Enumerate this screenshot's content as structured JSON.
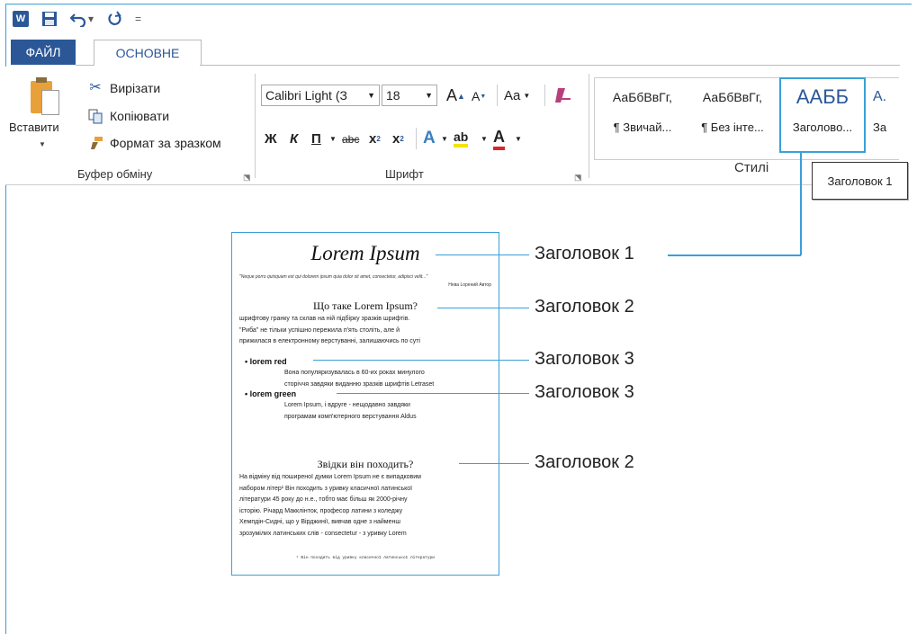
{
  "quick_access": {
    "word_icon": "word-app-icon",
    "save_icon": "save-icon",
    "undo_icon": "undo-icon",
    "undo_menu": "▾",
    "redo_icon": "redo-icon",
    "customize": "="
  },
  "tabs": {
    "file": "ФАЙЛ",
    "home": "ОСНОВНЕ"
  },
  "clipboard": {
    "paste": "Вставити",
    "cut": "Вирізати",
    "copy": "Копіювати",
    "format_painter": "Формат за зразком",
    "group_label": "Буфер обміну"
  },
  "font": {
    "font_name": "Calibri Light (З",
    "font_size": "18",
    "grow": "A",
    "shrink": "A",
    "case": "Aa",
    "bold": "Ж",
    "italic": "К",
    "underline": "П",
    "strike": "abc",
    "subscript": "x",
    "superscript": "x",
    "text_effects": "A",
    "highlight": "ab",
    "font_color": "A",
    "group_label": "Шрифт"
  },
  "styles": {
    "tiles": [
      {
        "sample": "АаБбВвГг,",
        "name": "¶ Звичай..."
      },
      {
        "sample": "АаБбВвГг,",
        "name": "¶ Без інте..."
      },
      {
        "sample": "ААББ",
        "name": "Заголово..."
      },
      {
        "sample": "А.",
        "name": "За"
      }
    ],
    "group_label": "Стилі",
    "tooltip": "Заголовок 1"
  },
  "document": {
    "title": "Lorem Ipsum",
    "quote": "\"Neque porro quisquam est qui dolorem ipsum quia dolor sit amet, consectetur, adipisci velit...\"",
    "author": "Нева Lорений  Автор",
    "h2_first": "Що таке Lorem Ipsum?",
    "para1": [
      "шрифтову гранку та склав на ній підбірку зразків шрифтів.",
      "\"Риба\" не тільки успішно пережила п'ять століть, але й",
      "прижилася в електронному верстуванні, залишаючись по суті"
    ],
    "h3_red": "lorem red",
    "para_red": [
      "Вона популяризувалась в 60-их роках минулого",
      "сторіччя завдяки виданню зразків шрифтів Letraset"
    ],
    "h3_green": "lorem green",
    "para_green": [
      "Lorem Ipsum, і вдруге - нещодавно завдяки",
      "програмам комп'ютерного верстування   Aldus"
    ],
    "h2_second": "Звідки він походить?",
    "para2": [
      "На відміну від поширеної думки Lorem Ipsum не є випадковим",
      "набором літер¹ Він походить з уривку класичної латинської",
      "літератури 45 року до н.е., тобто має більш як 2000-річну",
      "історію. Річард Макклінток, професор латини з коледжу",
      "Хемпдін-Сидні, що у Вірджинії, вивчав одне з найменш",
      "зрозумілих латинських слів - consectetur - з уривку Lorem"
    ],
    "footnote": "¹ Він походить від уривку класичної латинської літератури"
  },
  "annotations": {
    "a1": "Заголовок 1",
    "a2": "Заголовок 2",
    "a3": "Заголовок 3",
    "a4": "Заголовок 3",
    "a5": "Заголовок 2"
  },
  "colors": {
    "accent": "#3aa0d8",
    "word_blue": "#2b5797"
  }
}
